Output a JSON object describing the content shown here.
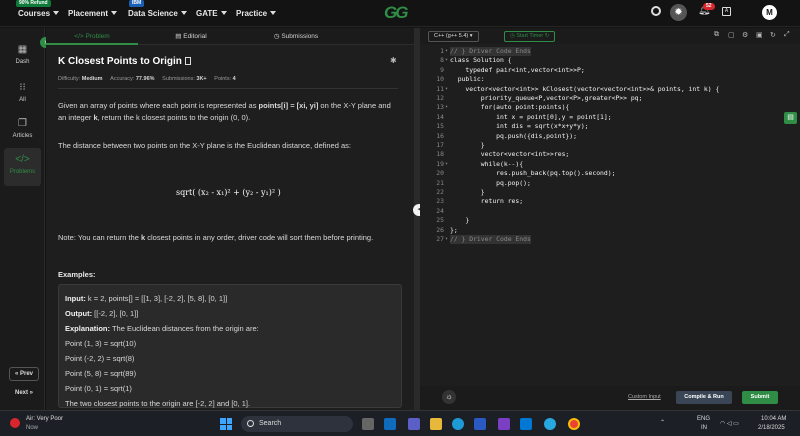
{
  "nav": {
    "courses_badge": "90% Refund",
    "courses": "Courses",
    "placement": "Placement",
    "ds_badge": "IBM",
    "data_science": "Data Science",
    "gate": "GATE",
    "practice": "Practice",
    "logo": "GG",
    "notif_count": "52",
    "avatar": "M"
  },
  "sidebar": {
    "items": [
      {
        "icon": "dash-icon",
        "label": "Dash"
      },
      {
        "icon": "all-icon",
        "label": "All"
      },
      {
        "icon": "articles-icon",
        "label": "Articles"
      },
      {
        "icon": "problems-icon",
        "label": "Problems"
      }
    ],
    "prev": "« Prev",
    "next": "Next »"
  },
  "tabs": {
    "problem": "Problem",
    "editorial": "Editorial",
    "submissions": "Submissions"
  },
  "problem": {
    "title": "K Closest Points to Origin",
    "difficulty_label": "Difficulty:",
    "difficulty": "Medium",
    "accuracy_label": "Accuracy:",
    "accuracy": "77.96%",
    "submissions_label": "Submissions:",
    "submissions": "3K+",
    "points_label": "Points:",
    "points": "4",
    "p1a": "Given an array of points where each point is represented as ",
    "p1b": "points[i] = [xi, yi]",
    "p1c": " on the X-Y plane and an integer ",
    "p1d": "k",
    "p1e": ", return the k closest points to the origin (0, 0).",
    "p2": "The distance between two points on the X-Y plane is the Euclidean distance, defined as:",
    "formula": "sqrt( (x₂ - x₁)² + (y₂ - y₁)² )",
    "p3a": "Note: You can return the ",
    "p3b": "k",
    "p3c": " closest points in any order, driver code will sort them before printing.",
    "examples_heading": "Examples:",
    "ex_input_label": "Input:",
    "ex_input": " k = 2, points[] = [[1, 3], [-2, 2], [5, 8], [0, 1]]",
    "ex_output_label": "Output:",
    "ex_output": " [[-2, 2], [0, 1]]",
    "ex_expl_label": "Explanation:",
    "ex_expl": " The Euclidean distances from the origin are:",
    "ex_lines": [
      "Point (1, 3) = sqrt(10)",
      "Point (-2, 2) = sqrt(8)",
      "Point (5, 8) = sqrt(89)",
      "Point (0, 1) = sqrt(1)",
      "The two closest points to the origin are [-2, 2] and [0, 1]."
    ]
  },
  "editor": {
    "language": "C++ (g++ 5.4)",
    "start_timer": "Start Timer",
    "lines": [
      {
        "n": "1",
        "fold": true,
        "text": "// } Driver Code Ends",
        "comment": true
      },
      {
        "n": "8",
        "fold": true,
        "text": "class Solution {"
      },
      {
        "n": "9",
        "fold": false,
        "text": "    typedef pair<int,vector<int>>P;"
      },
      {
        "n": "10",
        "fold": false,
        "text": "  public:"
      },
      {
        "n": "11",
        "fold": true,
        "text": "    vector<vector<int>> kClosest(vector<vector<int>>& points, int k) {"
      },
      {
        "n": "12",
        "fold": false,
        "text": "        priority_queue<P,vector<P>,greater<P>> pq;"
      },
      {
        "n": "13",
        "fold": true,
        "text": "        for(auto point:points){"
      },
      {
        "n": "14",
        "fold": false,
        "text": "            int x = point[0],y = point[1];"
      },
      {
        "n": "15",
        "fold": false,
        "text": "            int dis = sqrt(x*x+y*y);"
      },
      {
        "n": "16",
        "fold": false,
        "text": "            pq.push({dis,point});"
      },
      {
        "n": "17",
        "fold": false,
        "text": "        }"
      },
      {
        "n": "18",
        "fold": false,
        "text": "        vector<vector<int>>res;"
      },
      {
        "n": "19",
        "fold": true,
        "text": "        while(k--){"
      },
      {
        "n": "20",
        "fold": false,
        "text": "            res.push_back(pq.top().second);"
      },
      {
        "n": "21",
        "fold": false,
        "text": "            pq.pop();"
      },
      {
        "n": "22",
        "fold": false,
        "text": "        }"
      },
      {
        "n": "23",
        "fold": false,
        "text": "        return res;"
      },
      {
        "n": "24",
        "fold": false,
        "text": ""
      },
      {
        "n": "25",
        "fold": false,
        "text": "    }"
      },
      {
        "n": "26",
        "fold": false,
        "text": "};"
      },
      {
        "n": "27",
        "fold": true,
        "text": "// } Driver Code Ends",
        "comment": true
      }
    ],
    "custom_input": "Custom Input",
    "compile_run": "Compile & Run",
    "submit": "Submit"
  },
  "taskbar": {
    "weather_title": "Air: Very Poor",
    "weather_sub": "Now",
    "search": "Search",
    "lang1": "ENG",
    "lang2": "IN",
    "time": "10:04 AM",
    "date": "2/18/2025"
  },
  "colors": {
    "accent": "#2f8d46",
    "submit": "#2f8d46",
    "compile": "#3a4656"
  }
}
